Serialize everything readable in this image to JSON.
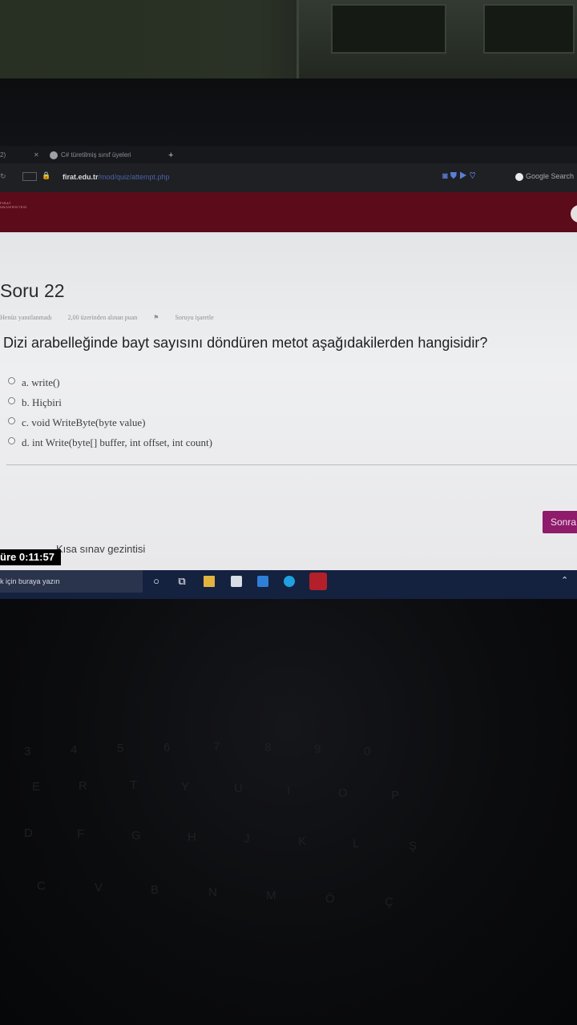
{
  "browser": {
    "tab1_label": "2)",
    "tab2_label": "C# türetilmiş sınıf üyeleri",
    "url_domain": "firat.edu.tr",
    "url_path": "/mod/quiz/attempt.php",
    "search_engine_label": "Google Search"
  },
  "site": {
    "logo_line1": "FIRAT",
    "logo_line2": "ÜNİVERSİTESİ"
  },
  "question": {
    "title": "Soru 22",
    "status": "Henüz yanıtlanmadı",
    "points": "2,00 üzerinden alınan puan",
    "flag_label": "Soruyu işaretle",
    "text": "Dizi arabelleğinde bayt sayısını döndüren metot aşağıdakilerden hangisidir?",
    "answers": [
      {
        "label": "a. write()",
        "selected": false
      },
      {
        "label": "b. Hiçbiri",
        "selected": false
      },
      {
        "label": "c. void WriteByte(byte value)",
        "selected": false
      },
      {
        "label": "d. int Write(byte[] buffer, int offset, int count)",
        "selected": false
      }
    ]
  },
  "navigation": {
    "next_label": "Sonra",
    "quiz_nav_label": "Kısa sınav gezintisi"
  },
  "timer": {
    "label": "üre 0:11:57"
  },
  "taskbar": {
    "search_placeholder": "k için buraya yazın"
  },
  "keyboard_keys": [
    "3",
    "4",
    "5",
    "6",
    "7",
    "8",
    "9",
    "0",
    "E",
    "R",
    "T",
    "Y",
    "U",
    "I",
    "O",
    "P",
    "D",
    "F",
    "G",
    "H",
    "J",
    "K",
    "L",
    "Ş",
    "C",
    "V",
    "B",
    "N",
    "M",
    "Ö",
    "Ç"
  ],
  "colors": {
    "site_header": "#5c0b1a",
    "next_button": "#8e1b6b",
    "taskbar": "#14213f"
  }
}
